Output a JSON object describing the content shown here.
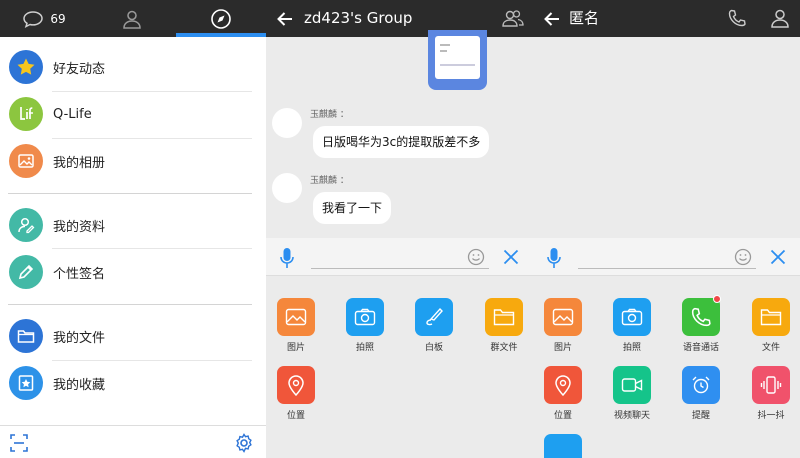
{
  "left_panel": {
    "topbar": {
      "message_count": "69"
    },
    "menu": [
      {
        "label": "好友动态",
        "icon": "star-icon",
        "color": "#2d74d6"
      },
      {
        "label": "Q-Life",
        "icon": "qlife-icon",
        "color": "#8cc63f"
      },
      {
        "label": "我的相册",
        "icon": "photo-album-icon",
        "color": "#f08a4b"
      },
      {
        "label": "我的资料",
        "icon": "profile-icon",
        "color": "#43b9a6"
      },
      {
        "label": "个性签名",
        "icon": "pencil-icon",
        "color": "#43b9a6"
      },
      {
        "label": "我的文件",
        "icon": "folder-icon",
        "color": "#2d74d6"
      },
      {
        "label": "我的收藏",
        "icon": "favorite-icon",
        "color": "#2d92e8"
      }
    ],
    "accent_color": "#2c8ef0"
  },
  "group_chat": {
    "title": "zd423's Group",
    "messages": [
      {
        "sender": "玉麒麟 ：",
        "text": "日版喝华为3c的提取版差不多"
      },
      {
        "sender": "玉麒麟 ：",
        "text": "我看了一下"
      }
    ],
    "tools": [
      {
        "label": "图片",
        "icon": "image-icon",
        "color": "#f5873b"
      },
      {
        "label": "拍照",
        "icon": "camera-icon",
        "color": "#1e9ff0"
      },
      {
        "label": "白板",
        "icon": "whiteboard-icon",
        "color": "#1e9ff0"
      },
      {
        "label": "群文件",
        "icon": "folder-icon",
        "color": "#f7a90e"
      },
      {
        "label": "位置",
        "icon": "location-icon",
        "color": "#f0563a"
      }
    ]
  },
  "anon_chat": {
    "title": "匿名",
    "tools": [
      {
        "label": "图片",
        "icon": "image-icon",
        "color": "#f5873b"
      },
      {
        "label": "拍照",
        "icon": "camera-icon",
        "color": "#1e9ff0"
      },
      {
        "label": "语音通话",
        "icon": "phone-icon",
        "color": "#3cbf3c"
      },
      {
        "label": "文件",
        "icon": "folder-icon",
        "color": "#f7a90e"
      },
      {
        "label": "位置",
        "icon": "location-icon",
        "color": "#f0563a"
      },
      {
        "label": "视频聊天",
        "icon": "video-icon",
        "color": "#15c48a"
      },
      {
        "label": "提醒",
        "icon": "alarm-icon",
        "color": "#2f8ff0"
      },
      {
        "label": "抖一抖",
        "icon": "shake-icon",
        "color": "#f0526b"
      }
    ]
  }
}
